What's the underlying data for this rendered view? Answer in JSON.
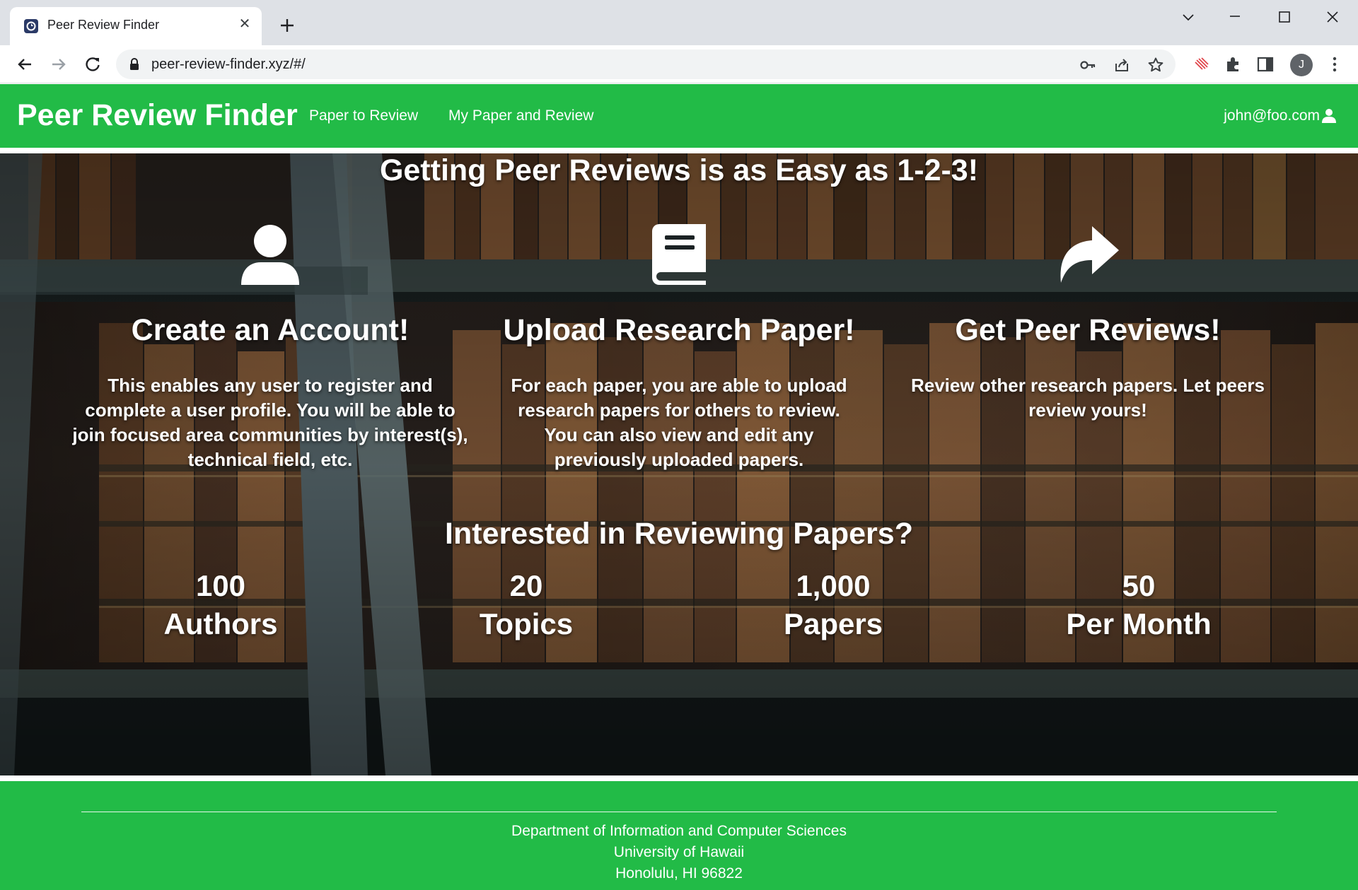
{
  "browser": {
    "tab_title": "Peer Review Finder",
    "url": "peer-review-finder.xyz/#/",
    "profile_initial": "J"
  },
  "navbar": {
    "brand": "Peer Review Finder",
    "links": [
      "Paper to Review",
      "My Paper and Review"
    ],
    "user": "john@foo.com"
  },
  "hero": {
    "title": "Getting Peer Reviews is as Easy as 1-2-3!",
    "steps": [
      {
        "icon": "user-icon",
        "title": "Create an Account!",
        "text": "This enables any user to register and complete a user profile. You will be able to join focused area communities by interest(s), technical field, etc."
      },
      {
        "icon": "book-icon",
        "title": "Upload Research Paper!",
        "text": "For each paper, you are able to upload research papers for others to review. You can also view and edit any previously uploaded papers."
      },
      {
        "icon": "share-arrow-icon",
        "title": "Get Peer Reviews!",
        "text": "Review other research papers. Let peers review yours!"
      }
    ],
    "interest_title": "Interested in Reviewing Papers?",
    "stats": [
      {
        "value": "100",
        "label": "Authors"
      },
      {
        "value": "20",
        "label": "Topics"
      },
      {
        "value": "1,000",
        "label": "Papers"
      },
      {
        "value": "50",
        "label": "Per Month"
      }
    ]
  },
  "footer": {
    "lines": [
      "Department of Information and Computer Sciences",
      "University of Hawaii",
      "Honolulu, HI 96822"
    ]
  },
  "colors": {
    "brand_green": "#22bb47",
    "browser_frame": "#dee1e6"
  }
}
